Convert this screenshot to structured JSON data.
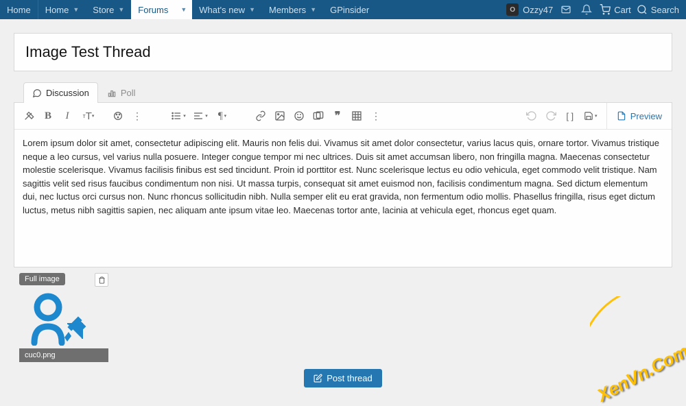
{
  "nav": {
    "items": [
      {
        "label": "Home",
        "caret": false
      },
      {
        "label": "Home",
        "caret": true
      },
      {
        "label": "Store",
        "caret": true
      },
      {
        "label": "Forums",
        "caret": true,
        "active": true
      },
      {
        "label": "What's new",
        "caret": true
      },
      {
        "label": "Members",
        "caret": true
      },
      {
        "label": "GPinsider",
        "caret": false
      }
    ],
    "user": "Ozzy47",
    "user_initial": "O",
    "cart": "Cart",
    "search": "Search"
  },
  "page": {
    "title": "Image Test Thread"
  },
  "tabs": {
    "discussion": "Discussion",
    "poll": "Poll"
  },
  "toolbar": {
    "preview": "Preview"
  },
  "editor": {
    "content": "Lorem ipsum dolor sit amet, consectetur adipiscing elit. Mauris non felis dui. Vivamus sit amet dolor consectetur, varius lacus quis, ornare tortor. Vivamus tristique neque a leo cursus, vel varius nulla posuere. Integer congue tempor mi nec ultrices. Duis sit amet accumsan libero, non fringilla magna. Maecenas consectetur molestie scelerisque. Vivamus facilisis finibus est sed tincidunt. Proin id porttitor est. Nunc scelerisque lectus eu odio vehicula, eget commodo velit tristique. Nam sagittis velit sed risus faucibus condimentum non nisi. Ut massa turpis, consequat sit amet euismod non, facilisis condimentum magna. Sed dictum elementum dui, nec luctus orci cursus non. Nunc rhoncus sollicitudin nibh. Nulla semper elit eu erat gravida, non fermentum odio mollis. Phasellus fringilla, risus eget dictum luctus, metus nibh sagittis sapien, nec aliquam ante ipsum vitae leo. Maecenas tortor ante, lacinia at vehicula eget, rhoncus eget quam."
  },
  "attachment": {
    "full_label": "Full image",
    "filename": "cuc0.png"
  },
  "buttons": {
    "post_thread": "Post thread"
  },
  "watermark": "XenVn.Com"
}
